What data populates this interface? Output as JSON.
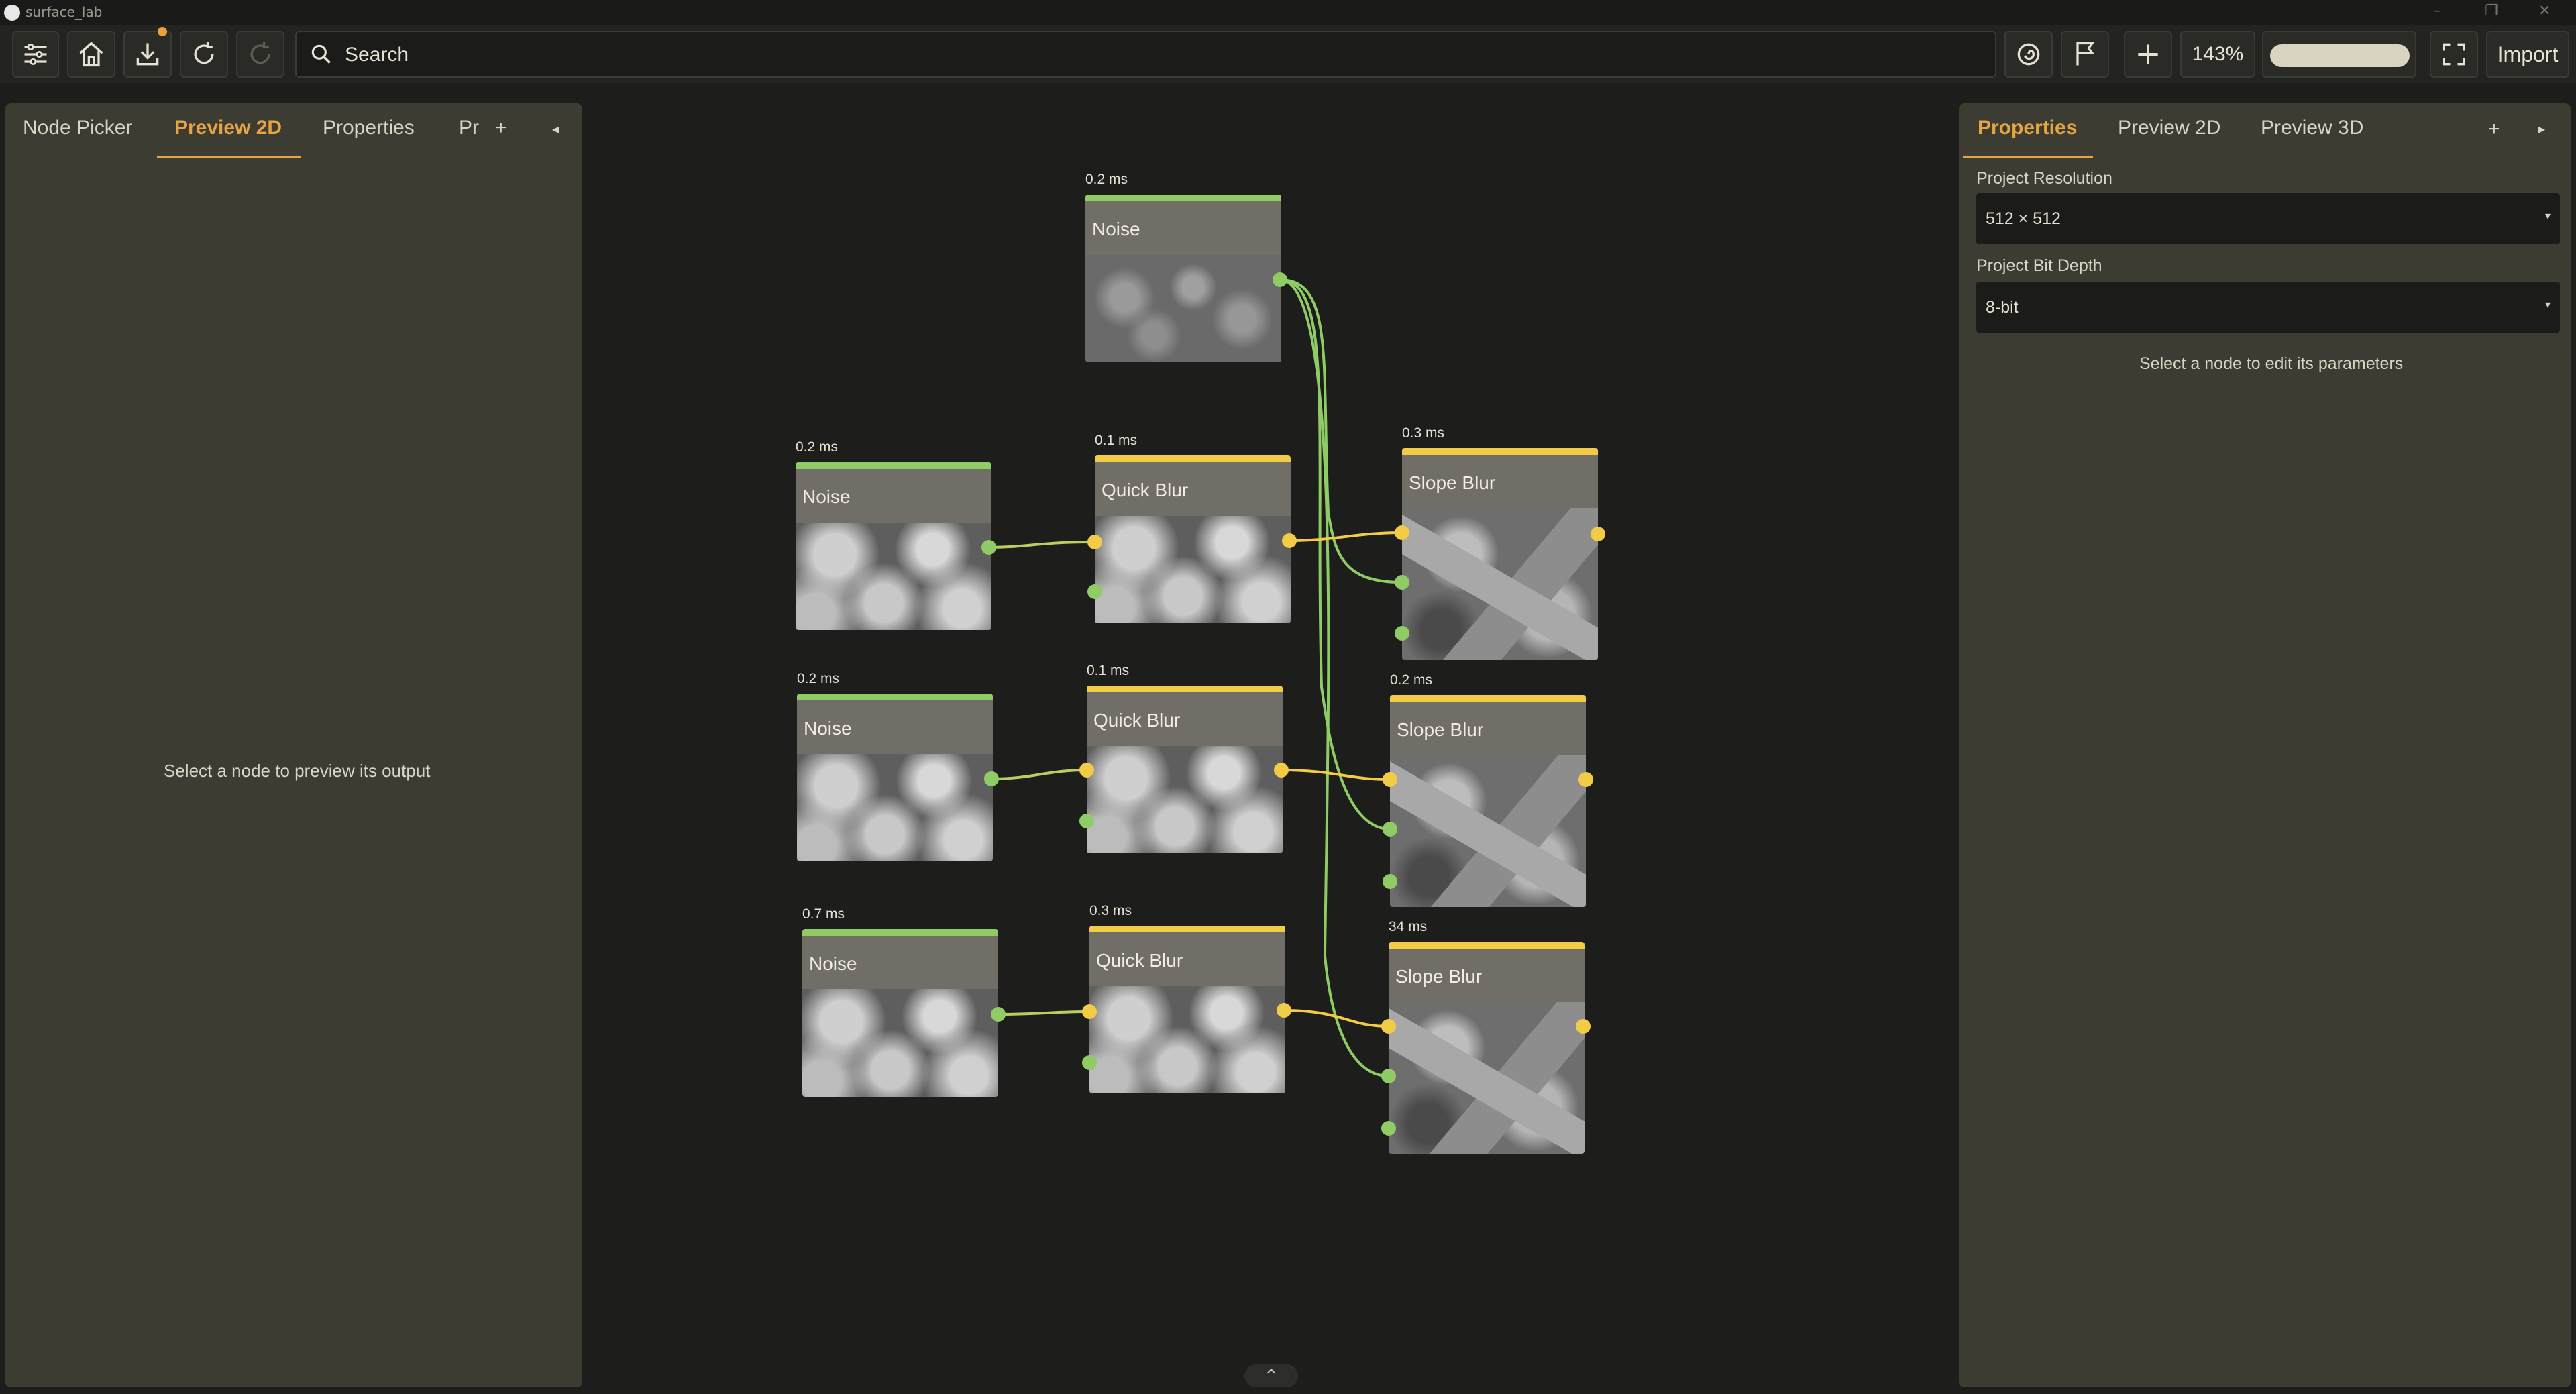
{
  "app": {
    "title": "surface_lab",
    "window_buttons": [
      "–",
      "❐",
      "✕"
    ]
  },
  "toolbar": {
    "buttons": [
      "menu-icon",
      "home-icon",
      "download-icon",
      "redo-icon",
      "refresh-icon",
      "graph-icon",
      "flag-icon",
      "add-icon",
      "fullscreen-icon"
    ],
    "search_placeholder": "Search",
    "zoom": "143%",
    "import_label": "Import",
    "notification_color": "#e9a23b"
  },
  "left_panel": {
    "tabs": [
      "Node Picker",
      "Preview 2D",
      "Properties",
      "Pr"
    ],
    "active_tab": "Preview 2D",
    "add_symbol": "+",
    "collapse_symbol": "◂",
    "message": "Select a node to preview its output"
  },
  "right_panel": {
    "tabs": [
      "Properties",
      "Preview 2D",
      "Preview 3D"
    ],
    "active_tab": "Properties",
    "add_symbol": "+",
    "collapse_symbol": "▸",
    "resolution_label": "Project Resolution",
    "resolution_value": "512 × 512",
    "bitdepth_label": "Project Bit Depth",
    "bitdepth_value": "8-bit",
    "message": "Select a node to edit its parameters"
  },
  "graph": {
    "accent_green": "#8fcc66",
    "accent_yellow": "#f2cb47",
    "nodes": [
      {
        "id": "noise_top",
        "title": "Noise",
        "time": "0.2 ms"
      },
      {
        "id": "noise_1",
        "title": "Noise",
        "time": "0.2 ms"
      },
      {
        "id": "blur_1",
        "title": "Quick Blur",
        "time": "0.1 ms"
      },
      {
        "id": "slope_1",
        "title": "Slope Blur",
        "time": "0.3 ms"
      },
      {
        "id": "noise_2",
        "title": "Noise",
        "time": "0.2 ms"
      },
      {
        "id": "blur_2",
        "title": "Quick Blur",
        "time": "0.1 ms"
      },
      {
        "id": "slope_2",
        "title": "Slope Blur",
        "time": "0.2 ms"
      },
      {
        "id": "noise_3",
        "title": "Noise",
        "time": "0.7 ms"
      },
      {
        "id": "blur_3",
        "title": "Quick Blur",
        "time": "0.3 ms"
      },
      {
        "id": "slope_3",
        "title": "Slope Blur",
        "time": "34 ms"
      }
    ],
    "bottom_handle": "^"
  }
}
